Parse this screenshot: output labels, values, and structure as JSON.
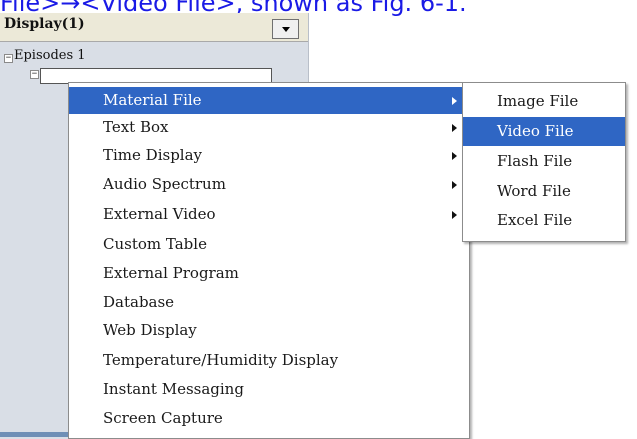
{
  "caption": "File>→<Video File>, shown as Fig. 6-1.",
  "panel": {
    "title": "Display(1)",
    "tree_root": "Episodes 1"
  },
  "context_menu": {
    "items": [
      {
        "label": "Material File",
        "has_submenu": true,
        "highlighted": true
      },
      {
        "label": "Text Box",
        "has_submenu": true
      },
      {
        "label": "Time Display",
        "has_submenu": true
      },
      {
        "label": "Audio Spectrum",
        "has_submenu": true
      },
      {
        "label": "External Video",
        "has_submenu": true
      },
      {
        "label": "Custom Table"
      },
      {
        "label": "External Program"
      },
      {
        "label": "Database"
      },
      {
        "label": "Web Display"
      },
      {
        "label": "Temperature/Humidity Display"
      },
      {
        "label": "Instant Messaging"
      },
      {
        "label": "Screen Capture"
      }
    ]
  },
  "submenu": {
    "items": [
      {
        "label": "Image File"
      },
      {
        "label": "Video File",
        "highlighted": true
      },
      {
        "label": "Flash File"
      },
      {
        "label": "Word File"
      },
      {
        "label": "Excel File"
      }
    ]
  },
  "colors": {
    "highlight": "#2f66c4",
    "caption": "#1a1ae6",
    "panel_bg": "#d9dee6"
  }
}
